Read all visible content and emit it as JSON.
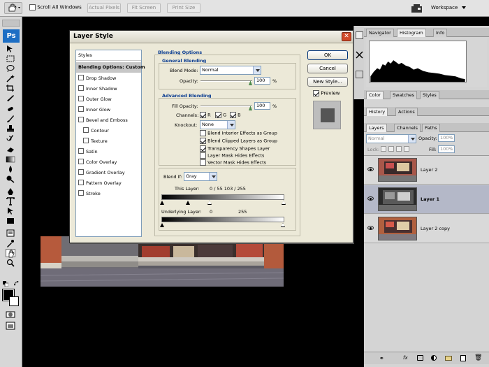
{
  "options_bar": {
    "scroll_all_windows_label": "Scroll All Windows",
    "scroll_all_checked": false,
    "buttons": [
      "Actual Pixels",
      "Fit Screen",
      "Print Size"
    ],
    "workspace_label": "Workspace"
  },
  "toolbox": {
    "logo": "Ps"
  },
  "dialog": {
    "title": "Layer Style",
    "styles_list": [
      {
        "label": "Styles",
        "checkbox": false,
        "selected": false
      },
      {
        "label": "Blending Options: Custom",
        "checkbox": false,
        "selected": true
      },
      {
        "label": "Drop Shadow",
        "checkbox": true,
        "checked": false
      },
      {
        "label": "Inner Shadow",
        "checkbox": true,
        "checked": false
      },
      {
        "label": "Outer Glow",
        "checkbox": true,
        "checked": false
      },
      {
        "label": "Inner Glow",
        "checkbox": true,
        "checked": false
      },
      {
        "label": "Bevel and Emboss",
        "checkbox": true,
        "checked": false
      },
      {
        "label": "Contour",
        "checkbox": true,
        "checked": false,
        "indent": true
      },
      {
        "label": "Texture",
        "checkbox": true,
        "checked": false,
        "indent": true
      },
      {
        "label": "Satin",
        "checkbox": true,
        "checked": false
      },
      {
        "label": "Color Overlay",
        "checkbox": true,
        "checked": false
      },
      {
        "label": "Gradient Overlay",
        "checkbox": true,
        "checked": false
      },
      {
        "label": "Pattern Overlay",
        "checkbox": true,
        "checked": false
      },
      {
        "label": "Stroke",
        "checkbox": true,
        "checked": false
      }
    ],
    "blending_options_title": "Blending Options",
    "general_blending_title": "General Blending",
    "blend_mode_label": "Blend Mode:",
    "blend_mode_value": "Normal",
    "opacity_label": "Opacity:",
    "opacity_value": "100",
    "percent": "%",
    "advanced_blending_title": "Advanced Blending",
    "fill_opacity_label": "Fill Opacity:",
    "fill_opacity_value": "100",
    "channels_label": "Channels:",
    "channels": [
      {
        "label": "R",
        "checked": true
      },
      {
        "label": "G",
        "checked": true
      },
      {
        "label": "B",
        "checked": true
      }
    ],
    "knockout_label": "Knockout:",
    "knockout_value": "None",
    "options": [
      {
        "label": "Blend Interior Effects as Group",
        "checked": false
      },
      {
        "label": "Blend Clipped Layers as Group",
        "checked": true
      },
      {
        "label": "Transparency Shapes Layer",
        "checked": true
      },
      {
        "label": "Layer Mask Hides Effects",
        "checked": false
      },
      {
        "label": "Vector Mask Hides Effects",
        "checked": false
      }
    ],
    "blend_if_label": "Blend If:",
    "blend_if_value": "Gray",
    "this_layer_label": "This Layer:",
    "this_layer_values": "0   /   55        103   /   255",
    "underlying_layer_label": "Underlying Layer:",
    "underlying_low": "0",
    "underlying_high": "255",
    "ok_label": "OK",
    "cancel_label": "Cancel",
    "new_style_label": "New Style...",
    "preview_label": "Preview",
    "preview_checked": true
  },
  "panels": {
    "navigator_tabs": [
      "Navigator",
      "Histogram",
      "Info"
    ],
    "color_tabs": [
      "Color",
      "Swatches",
      "Styles"
    ],
    "history_tabs": [
      "History",
      "Actions"
    ],
    "layers_tabs": [
      "Layers",
      "Channels",
      "Paths"
    ],
    "layer_blend_mode": "Normal",
    "opacity_label": "Opacity:",
    "opacity_value": "100%",
    "lock_label": "Lock:",
    "fill_label": "Fill:",
    "fill_value": "100%",
    "layers": [
      {
        "name": "Layer 2",
        "selected": false,
        "visible": true
      },
      {
        "name": "Layer 1",
        "selected": true,
        "visible": true
      },
      {
        "name": "Layer 2 copy",
        "selected": false,
        "visible": true
      }
    ]
  },
  "colors": {
    "accent_blue": "#0b3d91",
    "selection_gray": "#c7c7c7",
    "layer_selected": "#b4b8c8"
  }
}
